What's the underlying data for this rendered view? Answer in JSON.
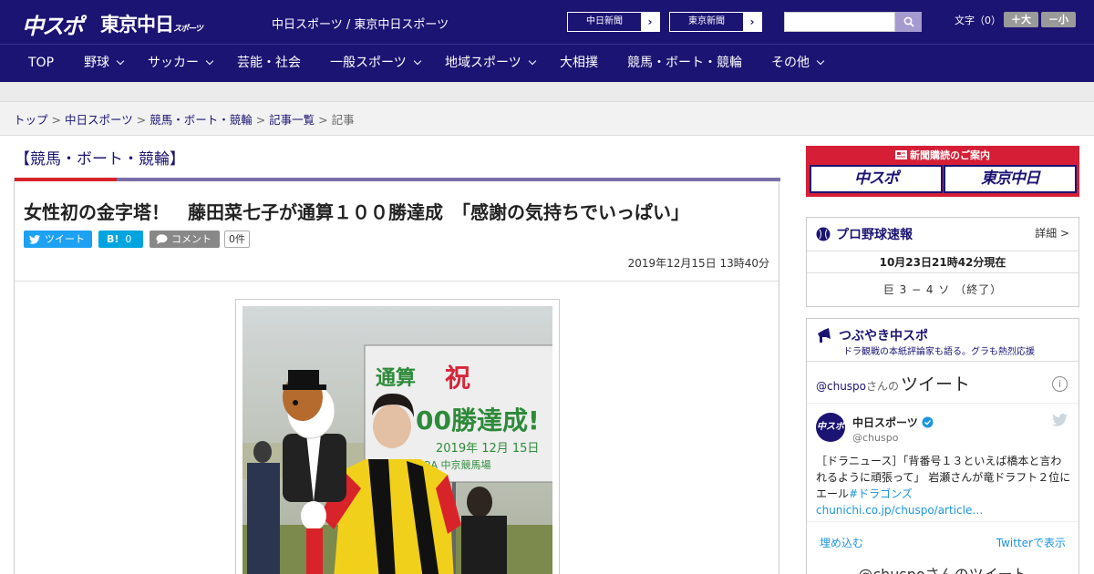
{
  "header": {
    "logo_chuspo": "中スポ",
    "logo_tokyo": "東京中日",
    "logo_tokyo_sub": "スポーツ",
    "site_name": "中日スポーツ / 東京中日スポーツ",
    "paper_links": [
      {
        "label": "中日新聞"
      },
      {
        "label": "東京新聞"
      }
    ],
    "search_placeholder": "",
    "font_label": "文字（0）",
    "font_larger": "＋大",
    "font_smaller": "－小"
  },
  "nav": {
    "items": [
      {
        "label": "TOP",
        "has_menu": false
      },
      {
        "label": "野球",
        "has_menu": true
      },
      {
        "label": "サッカー",
        "has_menu": true
      },
      {
        "label": "芸能・社会",
        "has_menu": false
      },
      {
        "label": "一般スポーツ",
        "has_menu": true
      },
      {
        "label": "地域スポーツ",
        "has_menu": true
      },
      {
        "label": "大相撲",
        "has_menu": false
      },
      {
        "label": "競馬・ボート・競輪",
        "has_menu": false
      },
      {
        "label": "その他",
        "has_menu": true
      }
    ]
  },
  "breadcrumb": {
    "items": [
      "トップ",
      "中日スポーツ",
      "競馬・ボート・競輪",
      "記事一覧"
    ],
    "current": "記事",
    "separator": ">"
  },
  "article": {
    "category": "【競馬・ボート・競輪】",
    "headline": "女性初の金字塔！　藤田菜七子が通算１００勝達成　「感謝の気持ちでいっぱい」",
    "share": {
      "tweet": "ツイート",
      "hatena": "B!",
      "hatena_count": "0",
      "comment": "コメント",
      "comment_count": "0件"
    },
    "timestamp": "2019年12月15日 13時40分",
    "photo": {
      "sign_line1": "通算",
      "sign_line1_mark": "祝",
      "sign_line2": "00勝達成!",
      "sign_date": "2019年 12月 15日",
      "sign_venue": "JRA 中京競馬場"
    }
  },
  "sidebar": {
    "ad": {
      "title": "新聞購読のご案内",
      "logo1": "中スポ",
      "logo2": "東京中日"
    },
    "baseball": {
      "title": "プロ野球速報",
      "detail": "詳細 >",
      "as_of": "10月23日21時42分現在",
      "score": "巨 3 − 4 ソ （終了）"
    },
    "tweets": {
      "title": "つぶやき中スポ",
      "subtitle": "ドラ観戦の本紙評論家も語る。グラも熱烈応援",
      "header_user": "@chuspo",
      "header_suffix": "さんの",
      "header_big": "ツイート",
      "account_name": "中日スポーツ",
      "account_handle": "@chuspo",
      "avatar_text": "中スポ",
      "text": "［ドラニュース］「背番号１３といえば橋本と言われるように頑張って」 岩瀬さんが竜ドラフト２位にエール",
      "hashtag": "#ドラゴンズ",
      "link": "chunichi.co.jp/chuspo/article…",
      "embed": "埋め込む",
      "view_on_twitter": "Twitterで表示",
      "footer": "@chuspoさんのツイート"
    }
  },
  "colors": {
    "brand_navy": "#1c1473",
    "accent_red": "#d8232a",
    "ad_red": "#d61f36",
    "twitter_blue": "#1b95e0",
    "share_twitter": "#1da1f2",
    "share_hatena": "#00a4de",
    "share_comment": "#888888"
  }
}
